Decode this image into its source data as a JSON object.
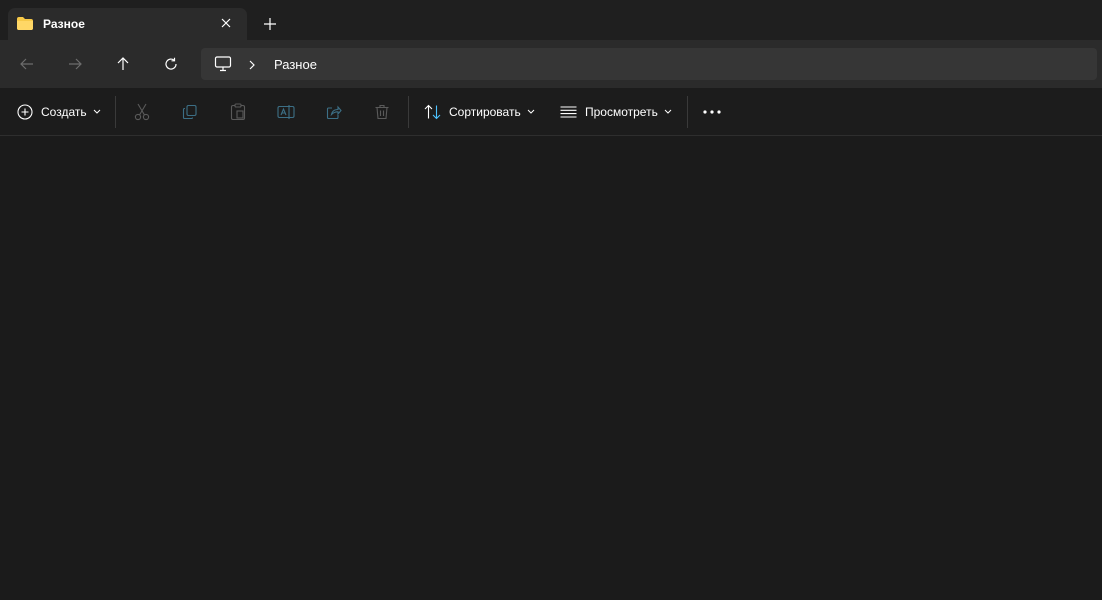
{
  "tab": {
    "title": "Разное",
    "icon": "folder-icon",
    "close_icon": "close-icon",
    "new_tab_icon": "plus-icon"
  },
  "nav": {
    "back_icon": "arrow-left-icon",
    "forward_icon": "arrow-right-icon",
    "up_icon": "arrow-up-icon",
    "refresh_icon": "refresh-icon"
  },
  "address": {
    "root_icon": "monitor-icon",
    "separator_icon": "chevron-right-icon",
    "crumb": "Разное"
  },
  "commands": {
    "create_label": "Создать",
    "sort_label": "Сортировать",
    "view_label": "Просмотреть",
    "cut_icon": "scissors-icon",
    "copy_icon": "copy-icon",
    "paste_icon": "paste-icon",
    "rename_icon": "rename-icon",
    "share_icon": "share-icon",
    "delete_icon": "trash-icon",
    "more_icon": "more-icon"
  },
  "colors": {
    "folder": "#f7c948",
    "accent": "#4cc2ff",
    "background": "#1c1c1c",
    "disabled_icon": "#5a5a5a"
  }
}
